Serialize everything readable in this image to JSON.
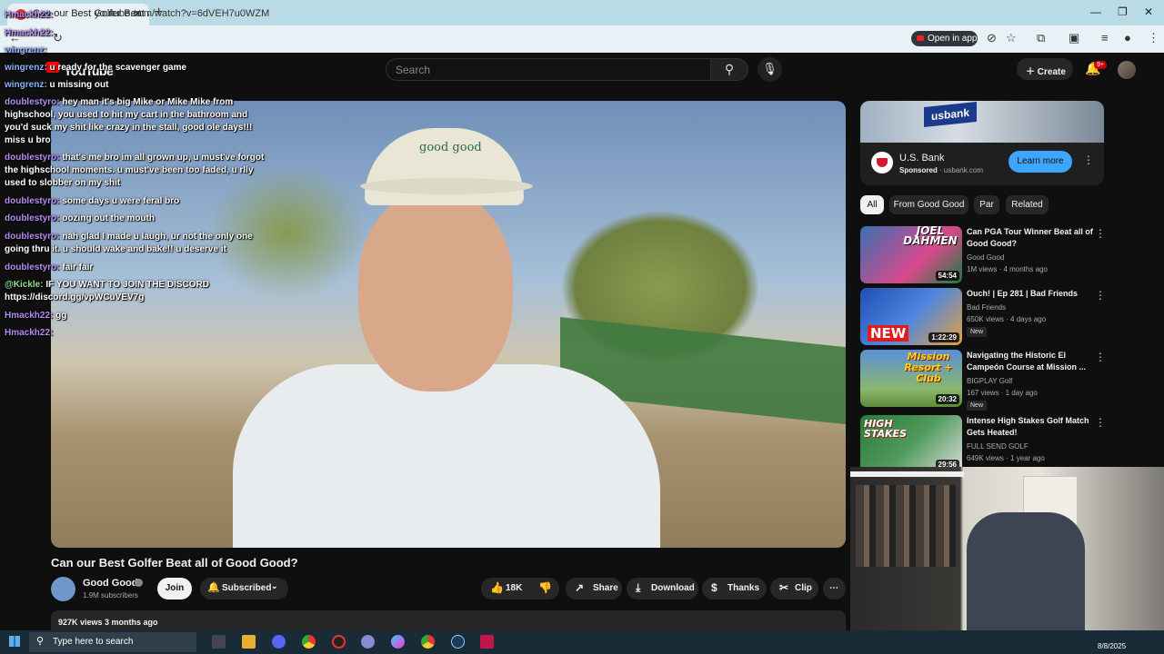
{
  "browser": {
    "tab_title": "Can our Best Golfer Beat all of Good Good?",
    "url": "youtube.com/watch?v=6dVEH7u0WZM",
    "open_in_app": "Open in app"
  },
  "youtube": {
    "logo_text": "YouTube",
    "search_placeholder": "Search",
    "create_label": "Create",
    "notifications_badge": "9+"
  },
  "chat": [
    {
      "user": "Hmackh22",
      "text": "",
      "color": "#b48cf0"
    },
    {
      "user": "Hmackh22",
      "text": "",
      "color": "#b48cf0"
    },
    {
      "user": "wingrenz",
      "text": "",
      "color": "#8fb0ff"
    },
    {
      "user": "wingrenz",
      "text": "u ready for the scavenger game",
      "color": "#8fb0ff"
    },
    {
      "user": "wingrenz",
      "text": "u missing out",
      "color": "#8fb0ff"
    },
    {
      "user": "doublestyro",
      "text": "hey man it's big Mike or Mike Mike from highschool, you used to hit my cart in the bathroom and you'd suck my shit like crazy in the stall, good ole days!!! miss u bro",
      "color": "#b48cf0"
    },
    {
      "user": "doublestyro",
      "text": "that's me bro im all grown up, u must've forgot the highschool moments. u must've been too faded, u rlly used to slobber on my shit",
      "color": "#b48cf0"
    },
    {
      "user": "doublestyro",
      "text": "some days u were feral bro",
      "color": "#b48cf0"
    },
    {
      "user": "doublestyro",
      "text": "oozing out the mouth",
      "color": "#b48cf0"
    },
    {
      "user": "doublestyro",
      "text": "nah glad I made u laugh, ur not the only one going thru it. u should wake and bake!! u deserve it",
      "color": "#b48cf0"
    },
    {
      "user": "doublestyro",
      "text": "fair fair",
      "color": "#b48cf0"
    },
    {
      "user": "@Kickle",
      "text": "IF YOU WANT TO JOIN THE DISCORD https://discord.gg/vpWCuVEV7g",
      "color": "#8fe08f"
    },
    {
      "user": "Hmackh22",
      "text": "gg",
      "color": "#b48cf0"
    },
    {
      "user": "Hmackh22",
      "text": "",
      "color": "#b48cf0"
    }
  ],
  "video": {
    "cap_text": "good good",
    "title": "Can our Best Golfer Beat all of Good Good?",
    "channel": "Good Good",
    "subscribers": "1.9M subscribers",
    "join_label": "Join",
    "subscribed_label": "Subscribed",
    "likes": "18K",
    "share_label": "Share",
    "download_label": "Download",
    "thanks_label": "Thanks",
    "clip_label": "Clip",
    "views_line": "927K views  3 months ago"
  },
  "ad": {
    "sign_text": "usbank",
    "name": "U.S. Bank",
    "sponsored": "Sponsored",
    "domain": "usbank.com",
    "cta": "Learn more"
  },
  "chips": [
    "All",
    "From Good Good",
    "Par",
    "Related"
  ],
  "recommendations": [
    {
      "title": "Can PGA Tour Winner Beat all of Good Good?",
      "channel": "Good Good",
      "meta": "1M views · 4 months ago",
      "duration": "54:54",
      "thumb_text": "JOEL DAHMEN",
      "new": ""
    },
    {
      "title": "Ouch! | Ep 281 | Bad Friends",
      "channel": "Bad Friends",
      "meta": "650K views · 4 days ago",
      "duration": "1:22:29",
      "thumb_text": "NEW",
      "new": "New"
    },
    {
      "title": "Navigating the Historic El Campeón Course at Mission ...",
      "channel": "BIGPLAY Golf",
      "meta": "167 views · 1 day ago",
      "duration": "20:32",
      "thumb_text": "Mission Resort + Club",
      "new": "New"
    },
    {
      "title": "Intense High Stakes Golf Match Gets Heated!",
      "channel": "FULL SEND GOLF",
      "meta": "649K views · 1 year ago",
      "duration": "29:56",
      "thumb_text": "HIGH STAKES",
      "new": ""
    }
  ],
  "taskbar": {
    "search_placeholder": "Type here to search",
    "date": "8/8/2025"
  }
}
